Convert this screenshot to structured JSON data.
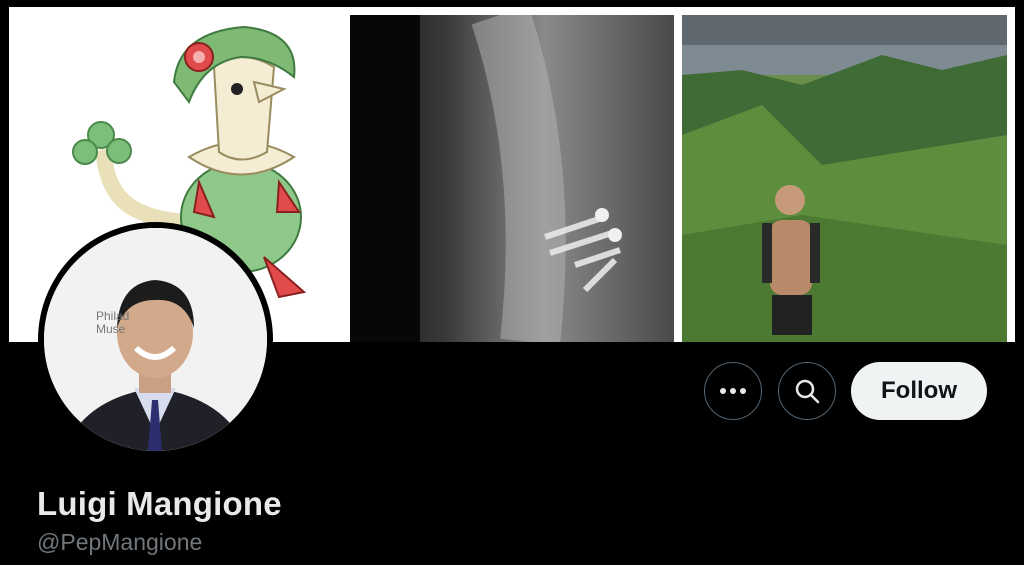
{
  "profile": {
    "name": "Luigi Mangione",
    "handle": "@PepMangione"
  },
  "actions": {
    "follow_label": "Follow",
    "more_icon": "more-horizontal-icon",
    "search_icon": "search-icon"
  },
  "avatar": {
    "backdrop_text_line1": "Philad",
    "backdrop_text_line2": "Muse"
  },
  "colors": {
    "background": "#000000",
    "name_text": "#e7e9ea",
    "handle_text": "#71767b",
    "follow_button_bg": "#eff3f4",
    "icon_button_border": "#536471"
  }
}
